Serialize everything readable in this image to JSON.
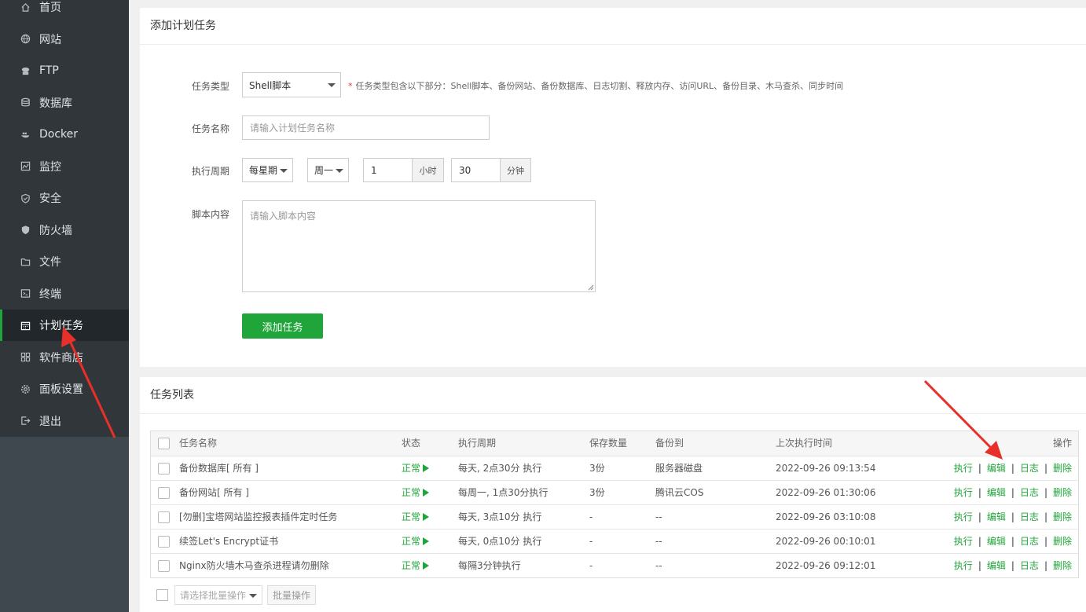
{
  "sidebar": {
    "items": [
      {
        "label": "首页",
        "icon": "home-icon"
      },
      {
        "label": "网站",
        "icon": "globe-icon"
      },
      {
        "label": "FTP",
        "icon": "ftp-icon"
      },
      {
        "label": "数据库",
        "icon": "database-icon"
      },
      {
        "label": "Docker",
        "icon": "docker-icon"
      },
      {
        "label": "监控",
        "icon": "monitor-icon"
      },
      {
        "label": "安全",
        "icon": "shield-icon"
      },
      {
        "label": "防火墙",
        "icon": "firewall-icon"
      },
      {
        "label": "文件",
        "icon": "folder-icon"
      },
      {
        "label": "终端",
        "icon": "terminal-icon"
      },
      {
        "label": "计划任务",
        "icon": "calendar-icon",
        "active": true
      },
      {
        "label": "软件商店",
        "icon": "apps-icon"
      },
      {
        "label": "面板设置",
        "icon": "gear-icon"
      },
      {
        "label": "退出",
        "icon": "logout-icon"
      }
    ]
  },
  "add_task": {
    "title": "添加计划任务",
    "type_label": "任务类型",
    "type_value": "Shell脚本",
    "type_hint": "任务类型包含以下部分：Shell脚本、备份网站、备份数据库、日志切割、释放内存、访问URL、备份目录、木马查杀、同步时间",
    "name_label": "任务名称",
    "name_placeholder": "请输入计划任务名称",
    "cycle_label": "执行周期",
    "cycle_type": "每星期",
    "cycle_day": "周一",
    "cycle_hour": "1",
    "hour_unit": "小时",
    "cycle_minute": "30",
    "minute_unit": "分钟",
    "script_label": "脚本内容",
    "script_placeholder": "请输入脚本内容",
    "submit": "添加任务"
  },
  "task_list": {
    "title": "任务列表",
    "columns": [
      "任务名称",
      "状态",
      "执行周期",
      "保存数量",
      "备份到",
      "上次执行时间",
      "操作"
    ],
    "rows": [
      {
        "name": "备份数据库[ 所有 ]",
        "status": "正常",
        "cycle": "每天, 2点30分 执行",
        "keep": "3份",
        "target": "服务器磁盘",
        "last": "2022-09-26 09:13:54"
      },
      {
        "name": "备份网站[ 所有 ]",
        "status": "正常",
        "cycle": "每周一, 1点30分执行",
        "keep": "3份",
        "target": "腾讯云COS",
        "last": "2022-09-26 01:30:06"
      },
      {
        "name": "[勿删]宝塔网站监控报表插件定时任务",
        "status": "正常",
        "cycle": "每天, 3点10分 执行",
        "keep": "-",
        "target": "--",
        "last": "2022-09-26 03:10:08"
      },
      {
        "name": "续签Let's Encrypt证书",
        "status": "正常",
        "cycle": "每天, 0点10分 执行",
        "keep": "-",
        "target": "--",
        "last": "2022-09-26 00:10:01"
      },
      {
        "name": "Nginx防火墙木马查杀进程请勿删除",
        "status": "正常",
        "cycle": "每隔3分钟执行",
        "keep": "-",
        "target": "--",
        "last": "2022-09-26 09:12:01"
      }
    ],
    "ops": [
      "执行",
      "编辑",
      "日志",
      "删除"
    ],
    "batch_placeholder": "请选择批量操作",
    "batch_button": "批量操作"
  },
  "colors": {
    "accent": "#20a53a",
    "sidebar": "#30363a",
    "annotation": "#e8302a"
  }
}
